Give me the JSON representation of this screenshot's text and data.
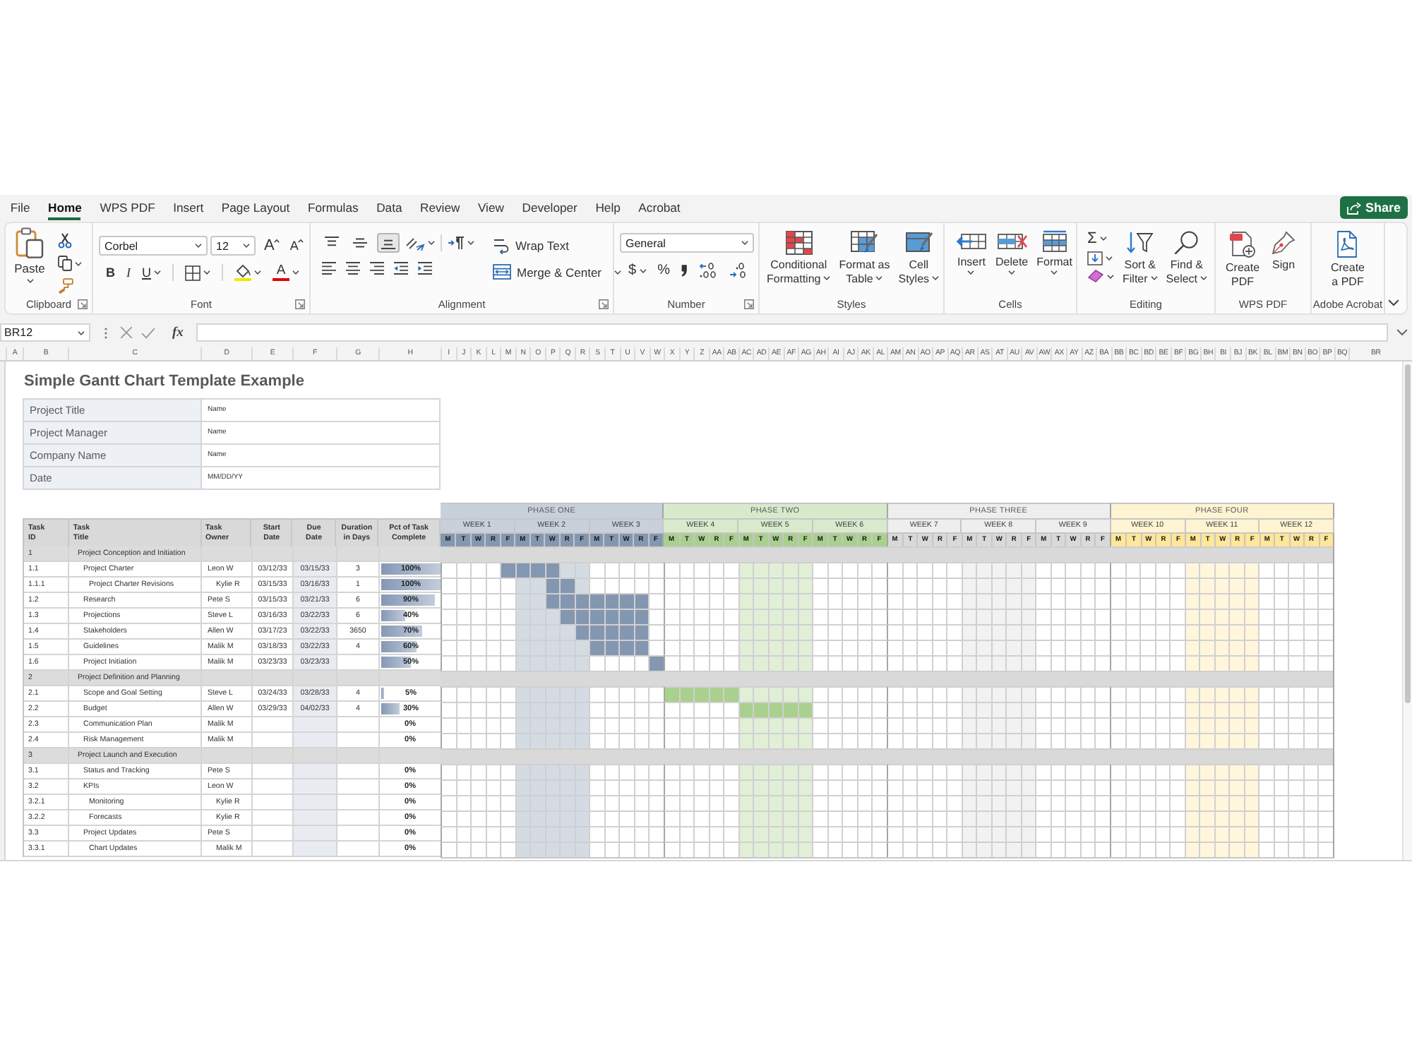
{
  "menu": {
    "tabs": [
      {
        "label": "File",
        "selected": false
      },
      {
        "label": "Home",
        "selected": true
      },
      {
        "label": "WPS PDF",
        "selected": false
      },
      {
        "label": "Insert",
        "selected": false
      },
      {
        "label": "Page Layout",
        "selected": false
      },
      {
        "label": "Formulas",
        "selected": false
      },
      {
        "label": "Data",
        "selected": false
      },
      {
        "label": "Review",
        "selected": false
      },
      {
        "label": "View",
        "selected": false
      },
      {
        "label": "Developer",
        "selected": false
      },
      {
        "label": "Help",
        "selected": false
      },
      {
        "label": "Acrobat",
        "selected": false
      }
    ],
    "share": "Share"
  },
  "ribbon": {
    "clipboard": {
      "label": "Clipboard",
      "paste": "Paste"
    },
    "font": {
      "label": "Font",
      "font_name": "Corbel",
      "font_size": "12",
      "grow": "A",
      "shrink": "A",
      "bold": "B",
      "italic": "I",
      "underline": "U",
      "font_color": "A"
    },
    "alignment": {
      "label": "Alignment",
      "vertical": [
        {
          "selected": false
        },
        {
          "selected": false
        },
        {
          "selected": true
        }
      ],
      "wrap_text": "Wrap Text",
      "merge": "Merge & Center"
    },
    "number": {
      "label": "Number",
      "format": "General",
      "currency": "$",
      "percent": "%"
    },
    "styles": {
      "label": "Styles",
      "buttons": [
        {
          "lines": [
            "Conditional",
            "Formatting"
          ]
        },
        {
          "lines": [
            "Format as",
            "Table"
          ]
        },
        {
          "lines": [
            "Cell",
            "Styles"
          ]
        }
      ]
    },
    "cells": {
      "label": "Cells",
      "buttons": [
        "Insert",
        "Delete",
        "Format"
      ]
    },
    "editing": {
      "label": "Editing",
      "autosum": "Σ",
      "buttons": [
        {
          "lines": [
            "Sort &",
            "Filter"
          ]
        },
        {
          "lines": [
            "Find &",
            "Select"
          ]
        }
      ]
    },
    "wps_pdf": {
      "label": "WPS PDF",
      "buttons": [
        {
          "lines": [
            "Create",
            "PDF"
          ]
        },
        {
          "lines": [
            "Sign"
          ]
        }
      ]
    },
    "acrobat": {
      "label": "Adobe Acrobat",
      "buttons": [
        {
          "lines": [
            "Create",
            "a PDF"
          ]
        }
      ]
    }
  },
  "formula_bar": {
    "name_box": "BR12",
    "fx": "fx"
  },
  "columns": [
    "A",
    "B",
    "C",
    "D",
    "E",
    "F",
    "G",
    "H",
    "I",
    "J",
    "K",
    "L",
    "M",
    "N",
    "O",
    "P",
    "Q",
    "R",
    "S",
    "T",
    "U",
    "V",
    "W",
    "X",
    "Y",
    "Z",
    "AA",
    "AB",
    "AC",
    "AD",
    "AE",
    "AF",
    "AG",
    "AH",
    "AI",
    "AJ",
    "AK",
    "AL",
    "AM",
    "AN",
    "AO",
    "AP",
    "AQ",
    "AR",
    "AS",
    "AT",
    "AU",
    "AV",
    "AW",
    "AX",
    "AY",
    "AZ",
    "BA",
    "BB",
    "BC",
    "BD",
    "BE",
    "BF",
    "BG",
    "BH",
    "BI",
    "BJ",
    "BK",
    "BL",
    "BM",
    "BN",
    "BO",
    "BP",
    "BQ",
    "BR"
  ],
  "sheet": {
    "title": "Simple Gantt Chart Template Example",
    "info": [
      {
        "label": "Project Title",
        "value": "Name"
      },
      {
        "label": "Project Manager",
        "value": "Name"
      },
      {
        "label": "Company Name",
        "value": "Name"
      },
      {
        "label": "Date",
        "value": "MM/DD/YY"
      }
    ],
    "table": {
      "columns": [
        {
          "lines": [
            "Task",
            "ID"
          ]
        },
        {
          "lines": [
            "Task",
            "Title"
          ]
        },
        {
          "lines": [
            "Task",
            "Owner"
          ]
        },
        {
          "lines": [
            "Start",
            "Date"
          ]
        },
        {
          "lines": [
            "Due",
            "Date"
          ]
        },
        {
          "lines": [
            "Duration",
            "in Days"
          ]
        },
        {
          "lines": [
            "Pct of Task",
            "Complete"
          ]
        }
      ],
      "rows": [
        {
          "id": "1",
          "title": "Project Conception and Initiation",
          "children": [
            {
              "id": "1.1",
              "title": "Project Charter",
              "owner": "Leon W",
              "start": "03/12/33",
              "due": "03/15/33",
              "duration": "3",
              "pct": "100%",
              "level": 1,
              "gantt": [
                false,
                false,
                false,
                false,
                true,
                true,
                true,
                true,
                false,
                false,
                false,
                false,
                false,
                false,
                false,
                false,
                false,
                false,
                false,
                false,
                false,
                false,
                false,
                false,
                false,
                false,
                false,
                false,
                false,
                false,
                false,
                false,
                false,
                false,
                false,
                false,
                false,
                false,
                false,
                false,
                false,
                false,
                false,
                false,
                false,
                false,
                false,
                false,
                false,
                false,
                false,
                false,
                false,
                false,
                false,
                false,
                false,
                false,
                false,
                false
              ],
              "children": [
                {
                  "id": "1.1.1",
                  "title": "Project Charter Revisions",
                  "owner": "Kylie R",
                  "start": "03/15/33",
                  "due": "03/16/33",
                  "duration": "1",
                  "pct": "100%",
                  "level": 1,
                  "gantt": [
                    false,
                    false,
                    false,
                    false,
                    false,
                    false,
                    false,
                    true,
                    true,
                    false,
                    false,
                    false,
                    false,
                    false,
                    false,
                    false,
                    false,
                    false,
                    false,
                    false,
                    false,
                    false,
                    false,
                    false,
                    false,
                    false,
                    false,
                    false,
                    false,
                    false,
                    false,
                    false,
                    false,
                    false,
                    false,
                    false,
                    false,
                    false,
                    false,
                    false,
                    false,
                    false,
                    false,
                    false,
                    false,
                    false,
                    false,
                    false,
                    false,
                    false,
                    false,
                    false,
                    false,
                    false,
                    false,
                    false,
                    false,
                    false,
                    false,
                    false
                  ]
                }
              ]
            },
            {
              "id": "1.2",
              "title": "Research",
              "owner": "Pete S",
              "start": "03/15/33",
              "due": "03/21/33",
              "duration": "6",
              "pct": "90%",
              "level": 0.9,
              "gantt": [
                false,
                false,
                false,
                false,
                false,
                false,
                false,
                true,
                true,
                true,
                true,
                true,
                true,
                true,
                false,
                false,
                false,
                false,
                false,
                false,
                false,
                false,
                false,
                false,
                false,
                false,
                false,
                false,
                false,
                false,
                false,
                false,
                false,
                false,
                false,
                false,
                false,
                false,
                false,
                false,
                false,
                false,
                false,
                false,
                false,
                false,
                false,
                false,
                false,
                false,
                false,
                false,
                false,
                false,
                false,
                false,
                false,
                false,
                false,
                false
              ]
            },
            {
              "id": "1.3",
              "title": "Projections",
              "owner": "Steve L",
              "start": "03/16/33",
              "due": "03/22/33",
              "duration": "6",
              "pct": "40%",
              "level": 0.4,
              "gantt": [
                false,
                false,
                false,
                false,
                false,
                false,
                false,
                false,
                true,
                true,
                true,
                true,
                true,
                true,
                false,
                false,
                false,
                false,
                false,
                false,
                false,
                false,
                false,
                false,
                false,
                false,
                false,
                false,
                false,
                false,
                false,
                false,
                false,
                false,
                false,
                false,
                false,
                false,
                false,
                false,
                false,
                false,
                false,
                false,
                false,
                false,
                false,
                false,
                false,
                false,
                false,
                false,
                false,
                false,
                false,
                false,
                false,
                false,
                false,
                false
              ]
            },
            {
              "id": "1.4",
              "title": "Stakeholders",
              "owner": "Allen W",
              "start": "03/17/23",
              "due": "03/22/33",
              "duration": "3650",
              "pct": "70%",
              "level": 0.7,
              "gantt": [
                false,
                false,
                false,
                false,
                false,
                false,
                false,
                false,
                false,
                true,
                true,
                true,
                true,
                true,
                false,
                false,
                false,
                false,
                false,
                false,
                false,
                false,
                false,
                false,
                false,
                false,
                false,
                false,
                false,
                false,
                false,
                false,
                false,
                false,
                false,
                false,
                false,
                false,
                false,
                false,
                false,
                false,
                false,
                false,
                false,
                false,
                false,
                false,
                false,
                false,
                false,
                false,
                false,
                false,
                false,
                false,
                false,
                false,
                false,
                false
              ]
            },
            {
              "id": "1.5",
              "title": "Guidelines",
              "owner": "Malik M",
              "start": "03/18/33",
              "due": "03/22/33",
              "duration": "4",
              "pct": "60%",
              "level": 0.6,
              "gantt": [
                false,
                false,
                false,
                false,
                false,
                false,
                false,
                false,
                false,
                false,
                true,
                true,
                true,
                true,
                false,
                false,
                false,
                false,
                false,
                false,
                false,
                false,
                false,
                false,
                false,
                false,
                false,
                false,
                false,
                false,
                false,
                false,
                false,
                false,
                false,
                false,
                false,
                false,
                false,
                false,
                false,
                false,
                false,
                false,
                false,
                false,
                false,
                false,
                false,
                false,
                false,
                false,
                false,
                false,
                false,
                false,
                false,
                false,
                false,
                false
              ]
            },
            {
              "id": "1.6",
              "title": "Project Initiation",
              "owner": "Malik M",
              "start": "03/23/33",
              "due": "03/23/33",
              "pct": "50%",
              "level": 0.5,
              "gantt": [
                false,
                false,
                false,
                false,
                false,
                false,
                false,
                false,
                false,
                false,
                false,
                false,
                false,
                false,
                true,
                false,
                false,
                false,
                false,
                false,
                false,
                false,
                false,
                false,
                false,
                false,
                false,
                false,
                false,
                false,
                false,
                false,
                false,
                false,
                false,
                false,
                false,
                false,
                false,
                false,
                false,
                false,
                false,
                false,
                false,
                false,
                false,
                false,
                false,
                false,
                false,
                false,
                false,
                false,
                false,
                false,
                false,
                false,
                false,
                false
              ]
            }
          ]
        },
        {
          "id": "2",
          "title": "Project Definition and Planning",
          "children": [
            {
              "id": "2.1",
              "title": "Scope and Goal Setting",
              "owner": "Steve L",
              "start": "03/24/33",
              "due": "03/28/33",
              "duration": "4",
              "pct": "5%",
              "level": 0.05,
              "gantt": [
                false,
                false,
                false,
                false,
                false,
                false,
                false,
                false,
                false,
                false,
                false,
                false,
                false,
                false,
                false,
                true,
                true,
                true,
                true,
                true,
                false,
                false,
                false,
                false,
                false,
                false,
                false,
                false,
                false,
                false,
                false,
                false,
                false,
                false,
                false,
                false,
                false,
                false,
                false,
                false,
                false,
                false,
                false,
                false,
                false,
                false,
                false,
                false,
                false,
                false,
                false,
                false,
                false,
                false,
                false,
                false,
                false,
                false,
                false,
                false
              ]
            },
            {
              "id": "2.2",
              "title": "Budget",
              "owner": "Allen W",
              "start": "03/29/33",
              "due": "04/02/33",
              "duration": "4",
              "pct": "30%",
              "level": 0.3,
              "gantt": [
                false,
                false,
                false,
                false,
                false,
                false,
                false,
                false,
                false,
                false,
                false,
                false,
                false,
                false,
                false,
                false,
                false,
                false,
                false,
                false,
                true,
                true,
                true,
                true,
                true,
                false,
                false,
                false,
                false,
                false,
                false,
                false,
                false,
                false,
                false,
                false,
                false,
                false,
                false,
                false,
                false,
                false,
                false,
                false,
                false,
                false,
                false,
                false,
                false,
                false,
                false,
                false,
                false,
                false,
                false,
                false,
                false,
                false,
                false,
                false
              ]
            },
            {
              "id": "2.3",
              "title": "Communication Plan",
              "owner": "Malik M",
              "pct": "0%"
            },
            {
              "id": "2.4",
              "title": "Risk Management",
              "owner": "Malik M",
              "pct": "0%"
            }
          ]
        },
        {
          "id": "3",
          "title": "Project Launch and Execution",
          "children": [
            {
              "id": "3.1",
              "title": "Status and Tracking",
              "owner": "Pete S",
              "pct": "0%"
            },
            {
              "id": "3.2",
              "title": "KPIs",
              "owner": "Leon W",
              "pct": "0%",
              "children": [
                {
                  "id": "3.2.1",
                  "title": "Monitoring",
                  "owner": "Kylie R",
                  "pct": "0%"
                },
                {
                  "id": "3.2.2",
                  "title": "Forecasts",
                  "owner": "Kylie R",
                  "pct": "0%"
                }
              ]
            },
            {
              "id": "3.3",
              "title": "Project Updates",
              "owner": "Pete S",
              "pct": "0%",
              "children": [
                {
                  "id": "3.3.1",
                  "title": "Chart Updates",
                  "owner": "Malik M",
                  "pct": "0%"
                }
              ]
            }
          ]
        }
      ]
    },
    "gantt": {
      "phases": [
        {
          "label": "PHASE ONE",
          "color": "#8497b0",
          "weeks": [
            {
              "label": "WEEK 1",
              "shaded": false,
              "days": [
                "M",
                "T",
                "W",
                "R",
                "F"
              ]
            },
            {
              "label": "WEEK 2",
              "shaded": true,
              "days": [
                "M",
                "T",
                "W",
                "R",
                "F"
              ]
            },
            {
              "label": "WEEK 3",
              "shaded": false,
              "days": [
                "M",
                "T",
                "W",
                "R",
                "F"
              ]
            }
          ]
        },
        {
          "label": "PHASE TWO",
          "color": "#a9d08e",
          "weeks": [
            {
              "label": "WEEK 4",
              "shaded": false,
              "days": [
                "M",
                "T",
                "W",
                "R",
                "F"
              ]
            },
            {
              "label": "WEEK 5",
              "shaded": true,
              "days": [
                "M",
                "T",
                "W",
                "R",
                "F"
              ]
            },
            {
              "label": "WEEK 6",
              "shaded": false,
              "days": [
                "M",
                "T",
                "W",
                "R",
                "F"
              ]
            }
          ]
        },
        {
          "label": "PHASE THREE",
          "color": "#d9d9d9",
          "weeks": [
            {
              "label": "WEEK 7",
              "shaded": false,
              "days": [
                "M",
                "T",
                "W",
                "R",
                "F"
              ]
            },
            {
              "label": "WEEK 8",
              "shaded": true,
              "days": [
                "M",
                "T",
                "W",
                "R",
                "F"
              ]
            },
            {
              "label": "WEEK 9",
              "shaded": false,
              "days": [
                "M",
                "T",
                "W",
                "R",
                "F"
              ]
            }
          ]
        },
        {
          "label": "PHASE FOUR",
          "color": "#ffe699",
          "weeks": [
            {
              "label": "WEEK 10",
              "shaded": false,
              "days": [
                "M",
                "T",
                "W",
                "R",
                "F"
              ]
            },
            {
              "label": "WEEK 11",
              "shaded": true,
              "days": [
                "M",
                "T",
                "W",
                "R",
                "F"
              ]
            },
            {
              "label": "WEEK 12",
              "shaded": false,
              "days": [
                "M",
                "T",
                "W",
                "R",
                "F"
              ]
            }
          ]
        }
      ]
    }
  }
}
